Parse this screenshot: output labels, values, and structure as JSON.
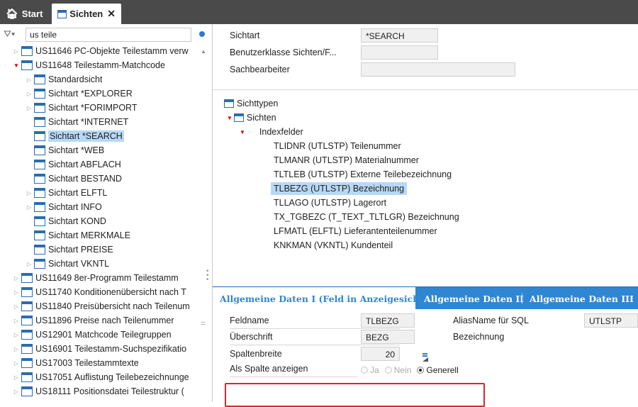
{
  "tabs": [
    {
      "label": "Start",
      "icon": "home-icon"
    },
    {
      "label": "Sichten",
      "icon": "window-icon",
      "close": "✕"
    }
  ],
  "filter": {
    "value": "us teile"
  },
  "tree": [
    {
      "label": "US11646 PC-Objekte Teilestamm verw",
      "level": 0,
      "state": "closed"
    },
    {
      "label": "US11648 Teilestamm-Matchcode",
      "level": 0,
      "state": "open"
    },
    {
      "label": "Standardsicht",
      "level": 1,
      "state": "closed"
    },
    {
      "label": "Sichtart *EXPLORER",
      "level": 1,
      "state": "closed"
    },
    {
      "label": "Sichtart *FORIMPORT",
      "level": 1,
      "state": "closed"
    },
    {
      "label": "Sichtart *INTERNET",
      "level": 1,
      "state": "none"
    },
    {
      "label": "Sichtart *SEARCH",
      "level": 1,
      "state": "none",
      "selected": true
    },
    {
      "label": "Sichtart *WEB",
      "level": 1,
      "state": "none"
    },
    {
      "label": "Sichtart ABFLACH",
      "level": 1,
      "state": "none"
    },
    {
      "label": "Sichtart BESTAND",
      "level": 1,
      "state": "none"
    },
    {
      "label": "Sichtart ELFTL",
      "level": 1,
      "state": "closed"
    },
    {
      "label": "Sichtart INFO",
      "level": 1,
      "state": "closed"
    },
    {
      "label": "Sichtart KOND",
      "level": 1,
      "state": "none"
    },
    {
      "label": "Sichtart MERKMALE",
      "level": 1,
      "state": "none"
    },
    {
      "label": "Sichtart PREISE",
      "level": 1,
      "state": "none"
    },
    {
      "label": "Sichtart VKNTL",
      "level": 1,
      "state": "closed"
    },
    {
      "label": "US11649 8er-Programm Teilestamm",
      "level": 0,
      "state": "closed"
    },
    {
      "label": "US11740 Konditionenübersicht nach T",
      "level": 0,
      "state": "closed"
    },
    {
      "label": "US11840 Preisübersicht nach Teilenum",
      "level": 0,
      "state": "closed"
    },
    {
      "label": "US11896 Preise nach Teilenummer",
      "level": 0,
      "state": "closed"
    },
    {
      "label": "US12901 Matchcode Teilegruppen",
      "level": 0,
      "state": "closed"
    },
    {
      "label": "US16901 Teilestamm-Suchspezifikatio",
      "level": 0,
      "state": "closed"
    },
    {
      "label": "US17003 Teilestammtexte",
      "level": 0,
      "state": "closed"
    },
    {
      "label": "US17051 Auflistung Teilebezeichnunge",
      "level": 0,
      "state": "closed"
    },
    {
      "label": "US18111 Positionsdatei Teilestruktur (",
      "level": 0,
      "state": "closed"
    }
  ],
  "header_form": {
    "sichtart_label": "Sichtart",
    "sichtart_value": "*SEARCH",
    "benutzerklasse_label": "Benutzerklasse Sichten/F...",
    "benutzerklasse_value": "",
    "sachbearbeiter_label": "Sachbearbeiter",
    "sachbearbeiter_value": ""
  },
  "types_tree": {
    "sichttypen": "Sichttypen",
    "sichten": "Sichten",
    "indexfelder": "Indexfelder",
    "fields": [
      "TLIDNR (UTLSTP) Teilenummer",
      "TLMANR (UTLSTP) Materialnummer",
      "TLTLEB (UTLSTP) Externe Teilebezeichnung",
      "TLBEZG (UTLSTP) Bezeichnung",
      "TLLAGO (UTLSTP) Lagerort",
      "TX_TGBEZC (T_TEXT_TLTLGR) Bezeichnung",
      "LFMATL (ELFTL) Lieferantenteilenummer",
      "KNKMAN (VKNTL) Kundenteil"
    ],
    "selected_index": 3
  },
  "detail_tabs": [
    "Allgemeine Daten I (Feld in Anzeigesicht)",
    "Allgemeine Daten II",
    "Allgemeine Daten III"
  ],
  "detail": {
    "feldname_label": "Feldname",
    "feldname_value": "TLBEZG",
    "alias_label": "AliasName für SQL",
    "alias_value": "UTLSTP",
    "ueberschrift_label": "Überschrift",
    "ueberschrift_value": "BEZG",
    "ueberschrift_text": "Bezeichnung",
    "spaltenbreite_label": "Spaltenbreite",
    "spaltenbreite_value": "20",
    "als_spalte_label": "Als Spalte anzeigen",
    "radio_options": [
      "Ja",
      "Nein",
      "Generell"
    ],
    "radio_selected": "Generell"
  },
  "colors": {
    "tabbar": "#4a4a4a",
    "accent": "#2f86d3",
    "selection": "#b8d8f5",
    "highlight": "#d9272e"
  }
}
